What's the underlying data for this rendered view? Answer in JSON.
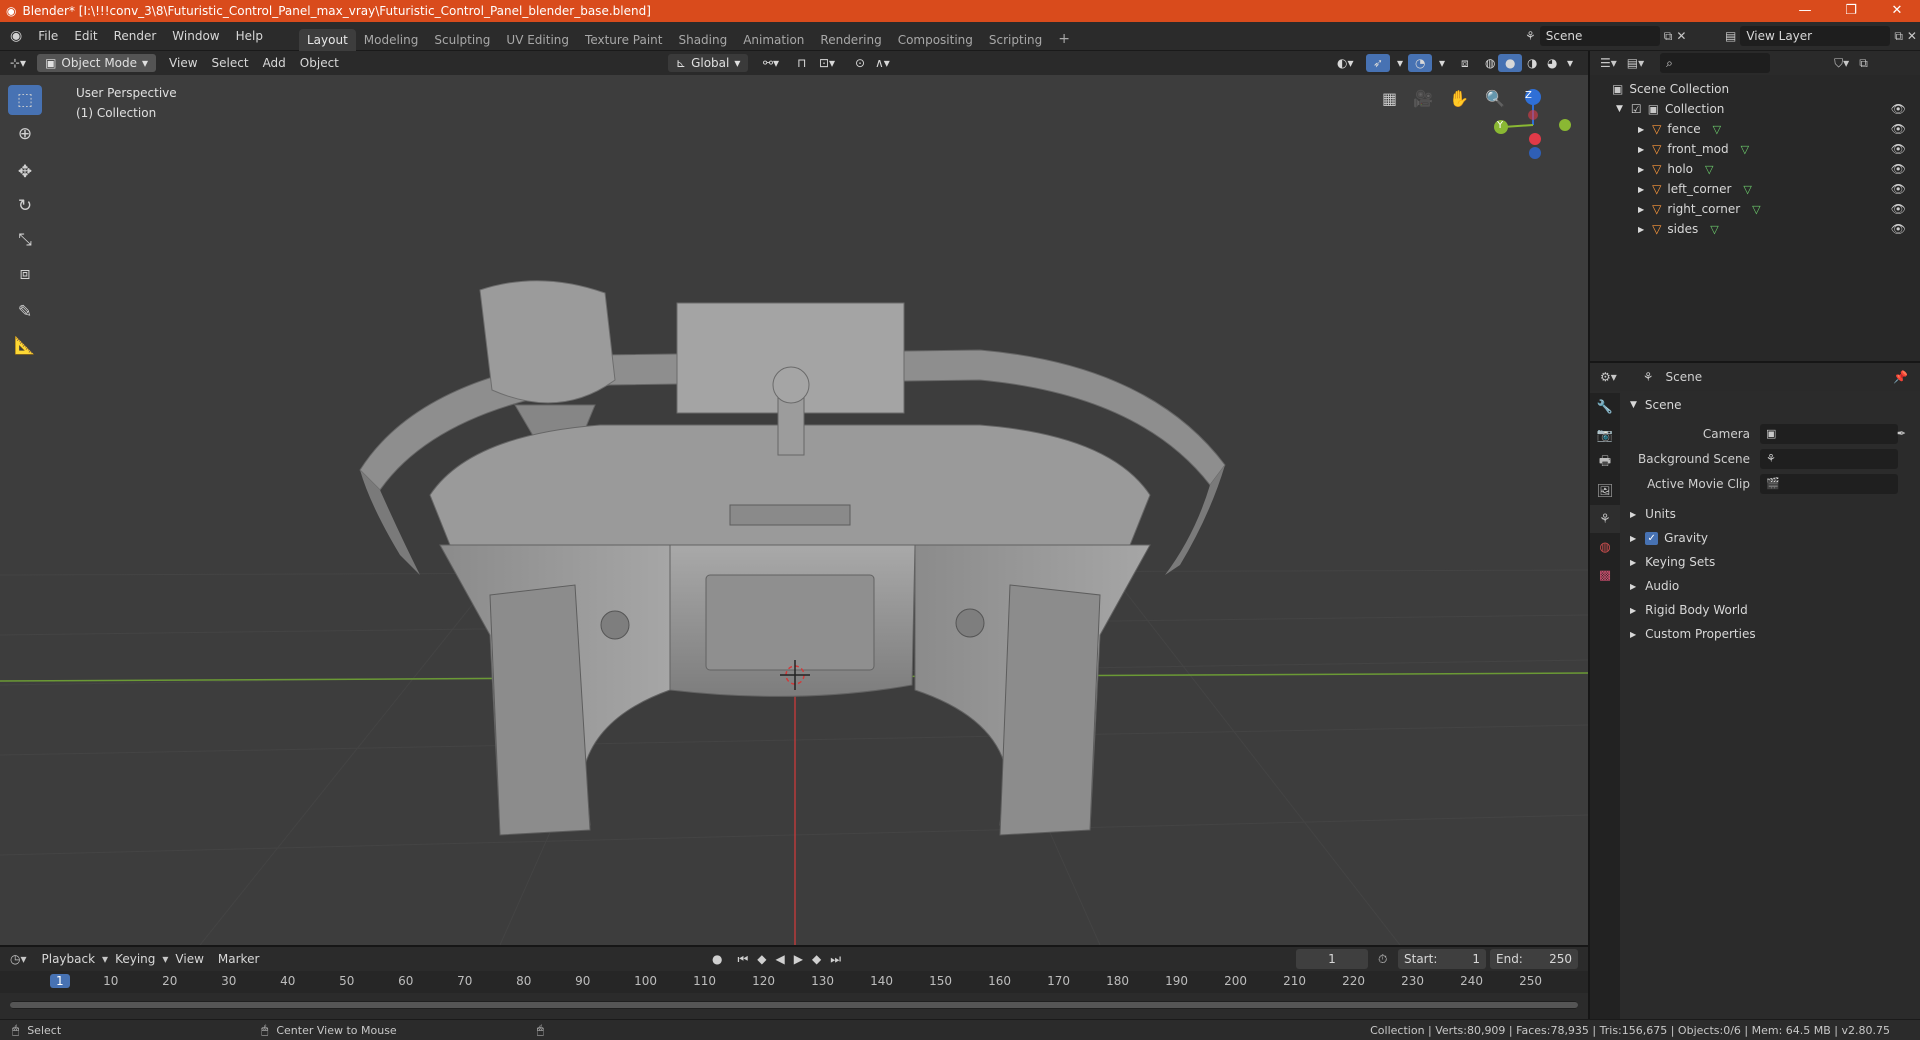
{
  "window": {
    "title": "Blender* [I:\\!!!conv_3\\8\\Futuristic_Control_Panel_max_vray\\Futuristic_Control_Panel_blender_base.blend]",
    "minimize": "—",
    "restore": "❐",
    "close": "✕"
  },
  "menu": [
    "File",
    "Edit",
    "Render",
    "Window",
    "Help"
  ],
  "workspaces": [
    "Layout",
    "Modeling",
    "Sculpting",
    "UV Editing",
    "Texture Paint",
    "Shading",
    "Animation",
    "Rendering",
    "Compositing",
    "Scripting"
  ],
  "workspace_add": "+",
  "scene_field": "Scene",
  "view_layer_field": "View Layer",
  "viewport_header": {
    "mode": "Object Mode",
    "menus": [
      "View",
      "Select",
      "Add",
      "Object"
    ],
    "transform_orientation": "Global"
  },
  "viewport": {
    "perspective_label": "User Perspective",
    "collection_label": "(1) Collection",
    "gizmo": {
      "z": "Z",
      "y": "Y"
    }
  },
  "outliner": {
    "search_placeholder": "",
    "scene_collection": "Scene Collection",
    "collection": "Collection",
    "objects": [
      "fence",
      "front_mod",
      "holo",
      "left_corner",
      "right_corner",
      "sides"
    ]
  },
  "properties": {
    "context": "Scene",
    "section": "Scene",
    "camera_label": "Camera",
    "background_scene_label": "Background Scene",
    "active_movie_clip_label": "Active Movie Clip",
    "subsections": [
      "Units",
      "Gravity",
      "Keying Sets",
      "Audio",
      "Rigid Body World",
      "Custom Properties"
    ],
    "gravity_checked": true
  },
  "timeline": {
    "menus": [
      "Playback",
      "Keying",
      "View",
      "Marker"
    ],
    "current_frame": "1",
    "start_label": "Start:",
    "start_value": "1",
    "end_label": "End:",
    "end_value": "250",
    "ruler": [
      "1",
      "10",
      "20",
      "30",
      "40",
      "50",
      "60",
      "70",
      "80",
      "90",
      "100",
      "110",
      "120",
      "130",
      "140",
      "150",
      "160",
      "170",
      "180",
      "190",
      "200",
      "210",
      "220",
      "230",
      "240",
      "250"
    ]
  },
  "statusbar": {
    "left_action": "Select",
    "middle_action": "Center View to Mouse",
    "stats": "Collection | Verts:80,909 | Faces:78,935 | Tris:156,675 | Objects:0/6 | Mem: 64.5 MB | v2.80.75"
  },
  "colors": {
    "title_bar": "#d94b1c",
    "active_tool": "#4772b3",
    "x_axis": "#b83b3b",
    "y_axis": "#6b9a35",
    "gizmo_z": "#2f6fd6",
    "gizmo_y": "#8ab833",
    "gizmo_x": "#e03a48"
  }
}
